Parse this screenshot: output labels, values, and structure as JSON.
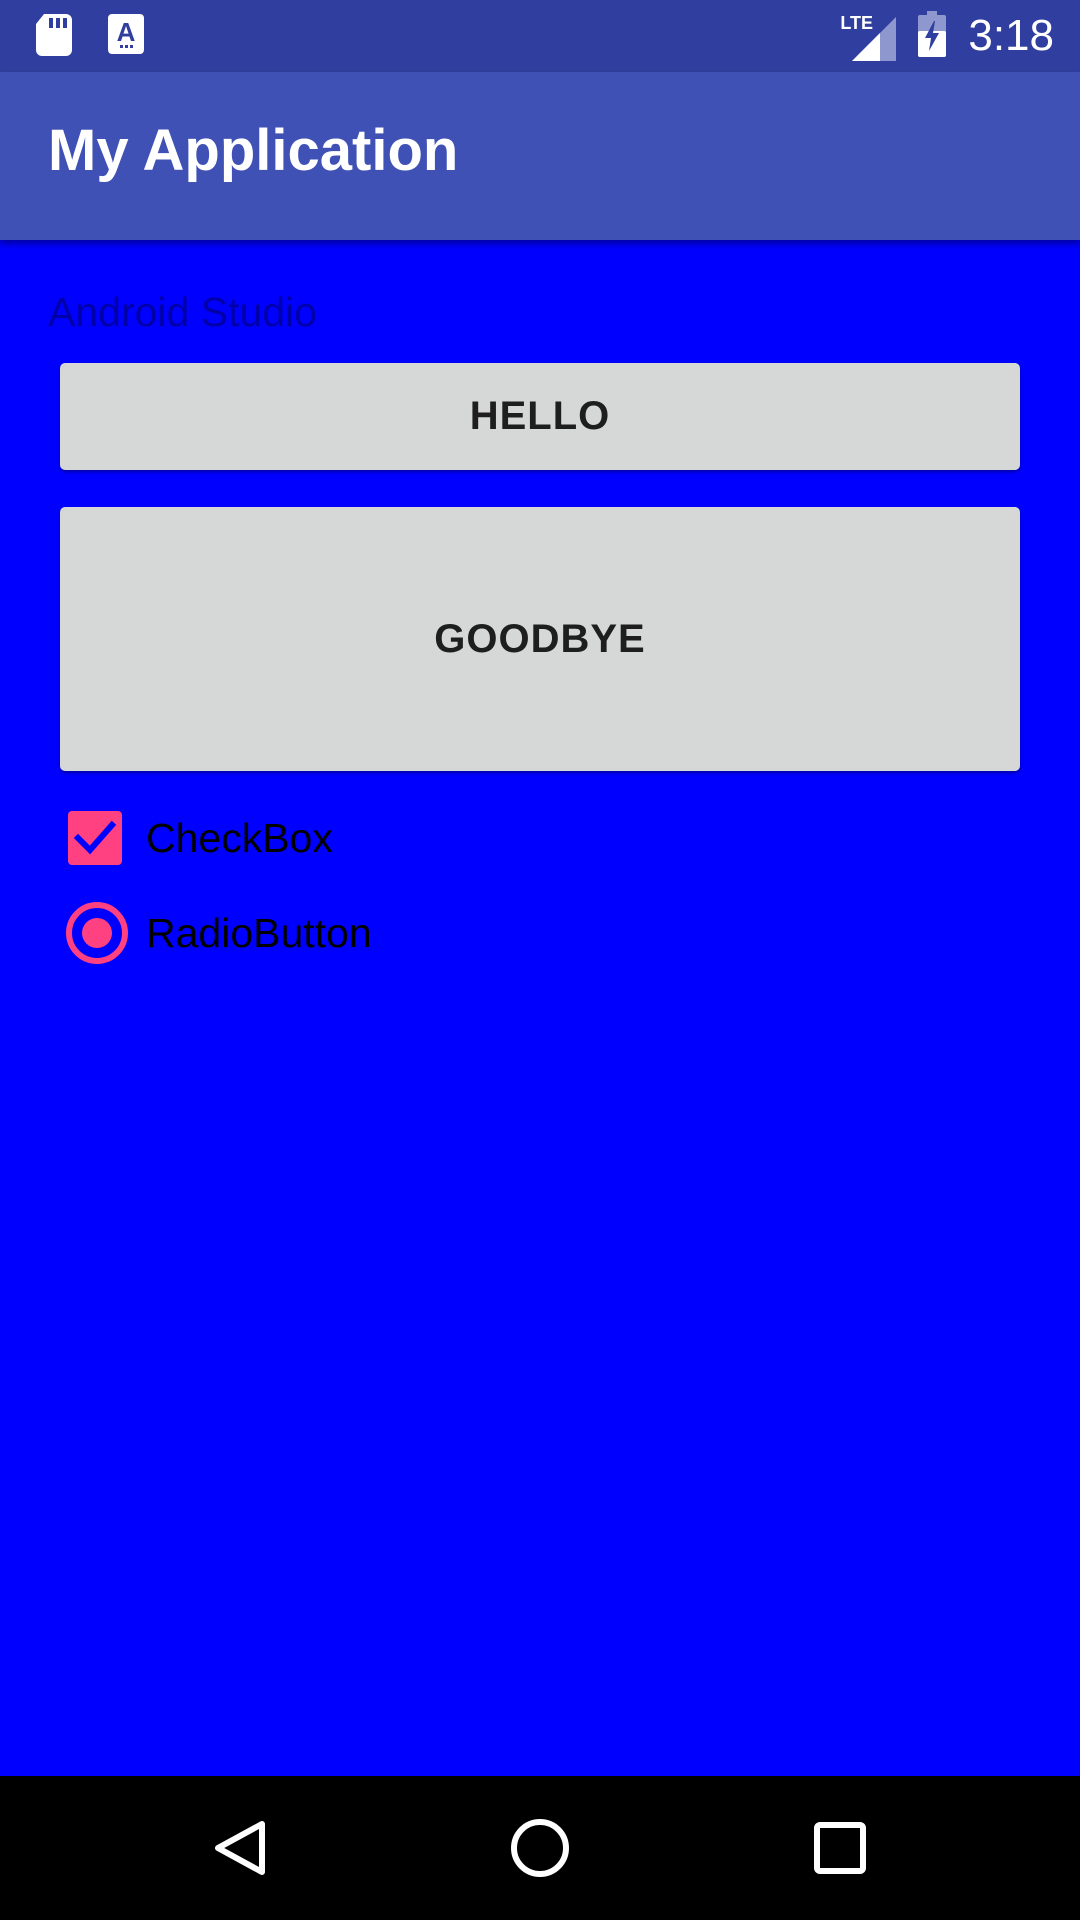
{
  "status_bar": {
    "time": "3:18",
    "network_label": "LTE",
    "icons": [
      "sd-card-icon",
      "keyboard-a-icon",
      "lte-signal-icon",
      "battery-charging-icon"
    ]
  },
  "app_bar": {
    "title": "My Application"
  },
  "content": {
    "label": "Android Studio",
    "hello_button": "HELLO",
    "goodbye_button": "GOODBYE",
    "checkbox": {
      "label": "CheckBox",
      "checked": true
    },
    "radio": {
      "label": "RadioButton",
      "selected": true
    }
  },
  "nav_bar": {
    "icons": [
      "back-icon",
      "home-icon",
      "recents-icon"
    ]
  },
  "colors": {
    "background": "#0000FF",
    "status_bar": "#303F9F",
    "app_bar": "#3F51B5",
    "accent": "#FF4081",
    "button": "#D6D7D7"
  }
}
